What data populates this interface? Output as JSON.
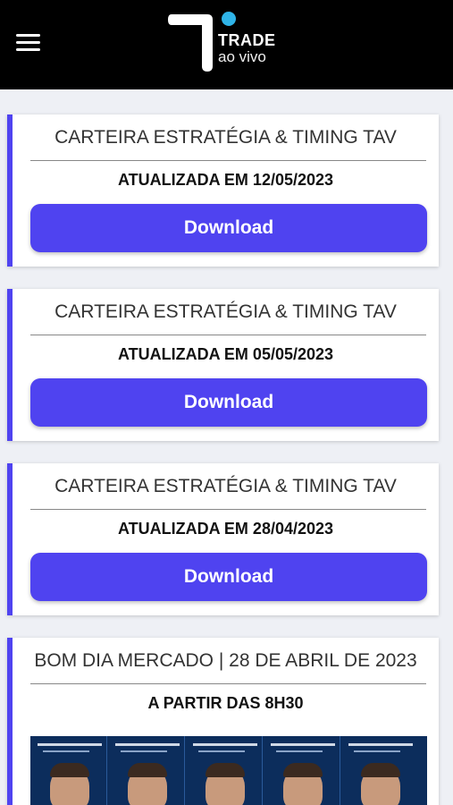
{
  "header": {
    "logo_title": "TRADE",
    "logo_subtitle": "ao vivo"
  },
  "cards": [
    {
      "title": "CARTEIRA ESTRATÉGIA & TIMING TAV",
      "subtitle": "ATUALIZADA EM 12/05/2023",
      "button_label": "Download"
    },
    {
      "title": "CARTEIRA ESTRATÉGIA & TIMING TAV",
      "subtitle": "ATUALIZADA EM 05/05/2023",
      "button_label": "Download"
    },
    {
      "title": "CARTEIRA ESTRATÉGIA & TIMING TAV",
      "subtitle": "ATUALIZADA EM 28/04/2023",
      "button_label": "Download"
    }
  ],
  "event_card": {
    "title": "BOM DIA MERCADO | 28 DE ABRIL DE 2023",
    "subtitle": "A PARTIR DAS 8H30"
  },
  "colors": {
    "accent": "#4f43f0",
    "header_bg": "#000000",
    "logo_dot": "#2fb4e8"
  }
}
